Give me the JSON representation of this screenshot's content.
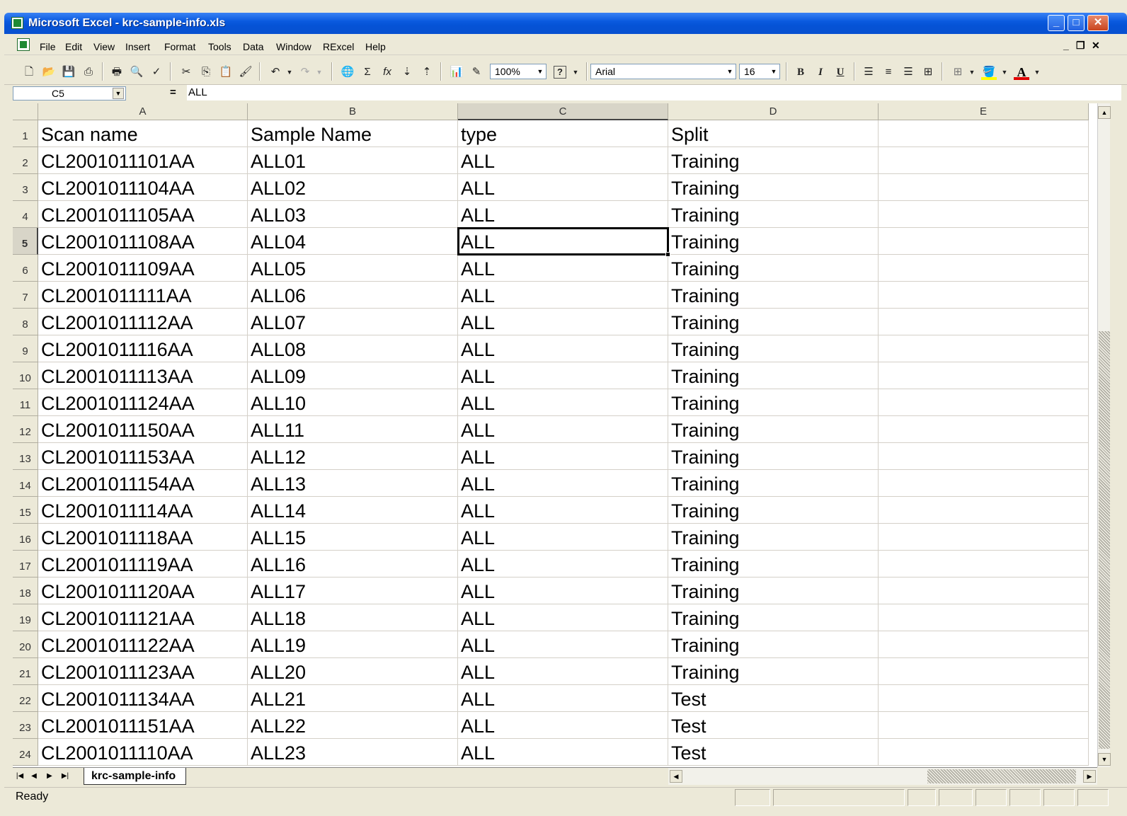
{
  "window": {
    "title": "Microsoft Excel - krc-sample-info.xls",
    "min_label": "_",
    "max_label": "□",
    "close_label": "✕"
  },
  "menu": {
    "items": [
      "File",
      "Edit",
      "View",
      "Insert",
      "Format",
      "Tools",
      "Data",
      "Window",
      "RExcel",
      "Help"
    ],
    "doc_min": "_",
    "doc_restore": "❐",
    "doc_close": "✕"
  },
  "toolbar": {
    "zoom": "100%",
    "font": "Arial",
    "font_size": "16",
    "bold_label": "B",
    "italic_label": "I",
    "underline_label": "U",
    "sigma_label": "Σ",
    "fx_label": "fx",
    "help_label": "?"
  },
  "formula_bar": {
    "name_box": "C5",
    "equals": "=",
    "value": "ALL"
  },
  "columns": [
    "A",
    "B",
    "C",
    "D",
    "E"
  ],
  "selected_column": "C",
  "selected_row": 5,
  "rows": [
    {
      "num": "1",
      "cells": [
        "Scan name",
        "Sample Name",
        "type",
        "Split",
        ""
      ]
    },
    {
      "num": "2",
      "cells": [
        "CL2001011101AA",
        "ALL01",
        "ALL",
        "Training",
        ""
      ]
    },
    {
      "num": "3",
      "cells": [
        "CL2001011104AA",
        "ALL02",
        "ALL",
        "Training",
        ""
      ]
    },
    {
      "num": "4",
      "cells": [
        "CL2001011105AA",
        "ALL03",
        "ALL",
        "Training",
        ""
      ]
    },
    {
      "num": "5",
      "cells": [
        "CL2001011108AA",
        "ALL04",
        "ALL",
        "Training",
        ""
      ]
    },
    {
      "num": "6",
      "cells": [
        "CL2001011109AA",
        "ALL05",
        "ALL",
        "Training",
        ""
      ]
    },
    {
      "num": "7",
      "cells": [
        "CL2001011111AA",
        "ALL06",
        "ALL",
        "Training",
        ""
      ]
    },
    {
      "num": "8",
      "cells": [
        "CL2001011112AA",
        "ALL07",
        "ALL",
        "Training",
        ""
      ]
    },
    {
      "num": "9",
      "cells": [
        "CL2001011116AA",
        "ALL08",
        "ALL",
        "Training",
        ""
      ]
    },
    {
      "num": "10",
      "cells": [
        "CL2001011113AA",
        "ALL09",
        "ALL",
        "Training",
        ""
      ]
    },
    {
      "num": "11",
      "cells": [
        "CL2001011124AA",
        "ALL10",
        "ALL",
        "Training",
        ""
      ]
    },
    {
      "num": "12",
      "cells": [
        "CL2001011150AA",
        "ALL11",
        "ALL",
        "Training",
        ""
      ]
    },
    {
      "num": "13",
      "cells": [
        "CL2001011153AA",
        "ALL12",
        "ALL",
        "Training",
        ""
      ]
    },
    {
      "num": "14",
      "cells": [
        "CL2001011154AA",
        "ALL13",
        "ALL",
        "Training",
        ""
      ]
    },
    {
      "num": "15",
      "cells": [
        "CL2001011114AA",
        "ALL14",
        "ALL",
        "Training",
        ""
      ]
    },
    {
      "num": "16",
      "cells": [
        "CL2001011118AA",
        "ALL15",
        "ALL",
        "Training",
        ""
      ]
    },
    {
      "num": "17",
      "cells": [
        "CL2001011119AA",
        "ALL16",
        "ALL",
        "Training",
        ""
      ]
    },
    {
      "num": "18",
      "cells": [
        "CL2001011120AA",
        "ALL17",
        "ALL",
        "Training",
        ""
      ]
    },
    {
      "num": "19",
      "cells": [
        "CL2001011121AA",
        "ALL18",
        "ALL",
        "Training",
        ""
      ]
    },
    {
      "num": "20",
      "cells": [
        "CL2001011122AA",
        "ALL19",
        "ALL",
        "Training",
        ""
      ]
    },
    {
      "num": "21",
      "cells": [
        "CL2001011123AA",
        "ALL20",
        "ALL",
        "Training",
        ""
      ]
    },
    {
      "num": "22",
      "cells": [
        "CL2001011134AA",
        "ALL21",
        "ALL",
        "Test",
        ""
      ]
    },
    {
      "num": "23",
      "cells": [
        "CL2001011151AA",
        "ALL22",
        "ALL",
        "Test",
        ""
      ]
    },
    {
      "num": "24",
      "cells": [
        "CL2001011110AA",
        "ALL23",
        "ALL",
        "Test",
        ""
      ]
    }
  ],
  "sheet_tab": "krc-sample-info",
  "status": "Ready",
  "colors": {
    "titlebar": "#0553d6",
    "chrome": "#ece9d8",
    "grid_line": "#d4d0c8"
  }
}
